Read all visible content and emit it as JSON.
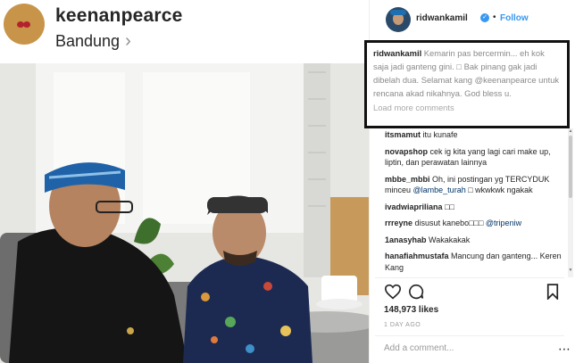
{
  "profile": {
    "username": "keenanpearce",
    "location": "Bandung"
  },
  "post": {
    "author": "ridwankamil",
    "follow_label": "Follow",
    "separator": "•",
    "caption_user": "ridwankamil",
    "caption_text": "Kemarin pas bercermin... eh kok saja jadi ganteng gini. □ Bak pinang gak jadi dibelah dua. Selamat kang @keenanpearce untuk rencana akad nikahnya. God bless u.",
    "load_more": "Load more comments",
    "likes": "148,973 likes",
    "time_ago": "1 DAY AGO",
    "add_comment_placeholder": "Add a comment..."
  },
  "comments": [
    {
      "user": "itsmamut",
      "text": "itu kunafe"
    },
    {
      "user": "novapshop",
      "text": "cek ig kita yang lagi cari make up, liptin, dan perawatan lainnya"
    },
    {
      "user": "mbbe_mbbi",
      "text": "Oh, ini postingan yg TERCYDUK minceu",
      "mention": "@lambe_turah",
      "text2": "□ wkwkwk ngakak"
    },
    {
      "user": "ivadwiapriliana",
      "text": "□□"
    },
    {
      "user": "rrreyne",
      "text": "disusut kanebo□□□",
      "mention": "@tripeniw"
    },
    {
      "user": "1anasyhab",
      "text": "Wakakakak"
    },
    {
      "user": "hanafiahmustafa",
      "text": "Mancung dan ganteng... Keren Kang"
    }
  ],
  "icons": {
    "heart": "heart-icon",
    "comment": "comment-icon",
    "bookmark": "bookmark-icon",
    "more": "more-icon",
    "verified": "verified-badge-icon",
    "chevron": "chevron-right-icon"
  },
  "colors": {
    "link_blue": "#3897f0",
    "highlight_border": "#111111"
  }
}
